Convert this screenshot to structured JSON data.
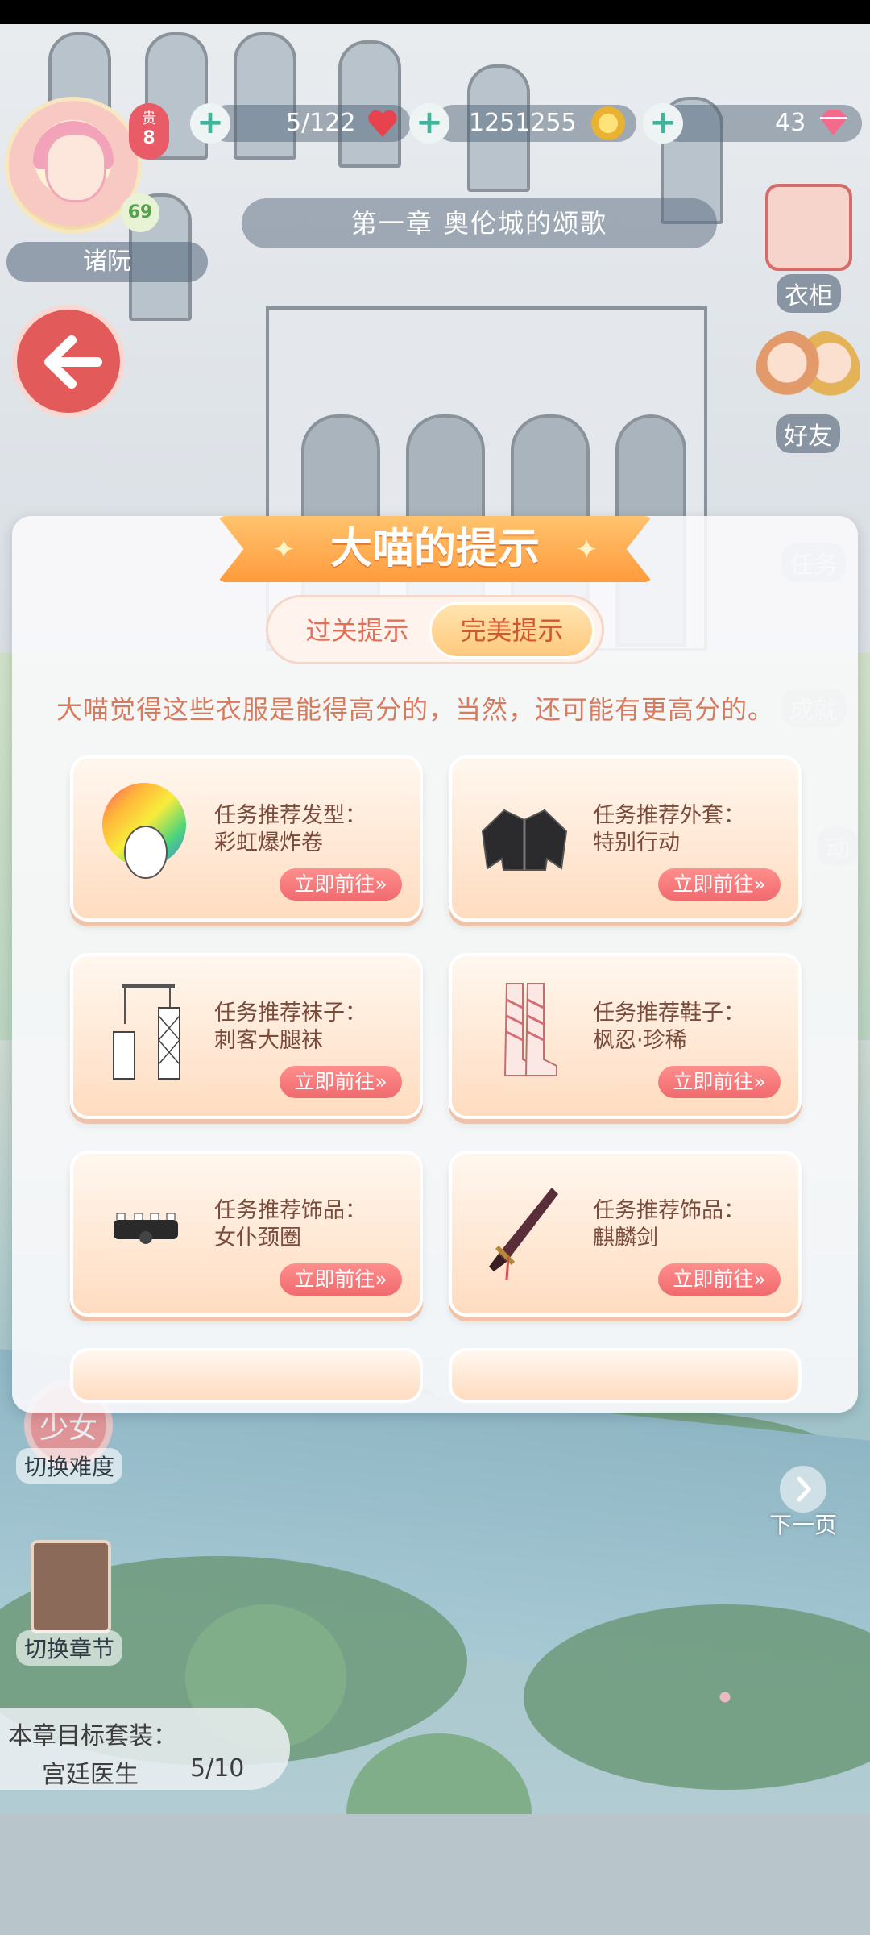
{
  "hud": {
    "vip_label": "贵",
    "vip_level": "8",
    "player_level": "69",
    "player_name": "诸阮",
    "stamina": "5/122",
    "coins": "1251255",
    "diamonds": "43",
    "chapter_title": "第一章 奥伦城的颂歌"
  },
  "side_right": {
    "wardrobe_label": "衣柜",
    "friends_label": "好友",
    "tasks_label": "任务",
    "achievements_label": "成就",
    "activity_label": "动",
    "next_page_label": "下一页"
  },
  "side_left": {
    "difficulty_badge": "少女",
    "difficulty_label": "切换难度",
    "chapter_book_label": "切换章节",
    "goal_title": "本章目标套装：",
    "goal_suit": "宫廷医生",
    "goal_progress": "5/10"
  },
  "dialog": {
    "title": "大喵的提示",
    "tabs": [
      {
        "label": "过关提示",
        "active": false
      },
      {
        "label": "完美提示",
        "active": true
      }
    ],
    "hint_text": "大喵觉得这些衣服是能得高分的，当然，还可能有更高分的。",
    "cards": [
      {
        "category": "任务推荐发型：",
        "name": "彩虹爆炸卷",
        "button": "立即前往»",
        "icon": "rainbow-afro-hair-icon"
      },
      {
        "category": "任务推荐外套：",
        "name": "特别行动",
        "button": "立即前往»",
        "icon": "black-jacket-icon"
      },
      {
        "category": "任务推荐袜子：",
        "name": "刺客大腿袜",
        "button": "立即前往»",
        "icon": "fishnet-stockings-icon"
      },
      {
        "category": "任务推荐鞋子：",
        "name": "枫忍·珍稀",
        "button": "立即前往»",
        "icon": "lace-up-boots-icon"
      },
      {
        "category": "任务推荐饰品：",
        "name": "女仆颈圈",
        "button": "立即前往»",
        "icon": "maid-collar-icon"
      },
      {
        "category": "任务推荐饰品：",
        "name": "麒麟剑",
        "button": "立即前往»",
        "icon": "sword-icon"
      }
    ]
  },
  "colors": {
    "accent_orange": "#ff9b3c",
    "button_red": "#f06a6e",
    "hint_text": "#d77b5e"
  }
}
